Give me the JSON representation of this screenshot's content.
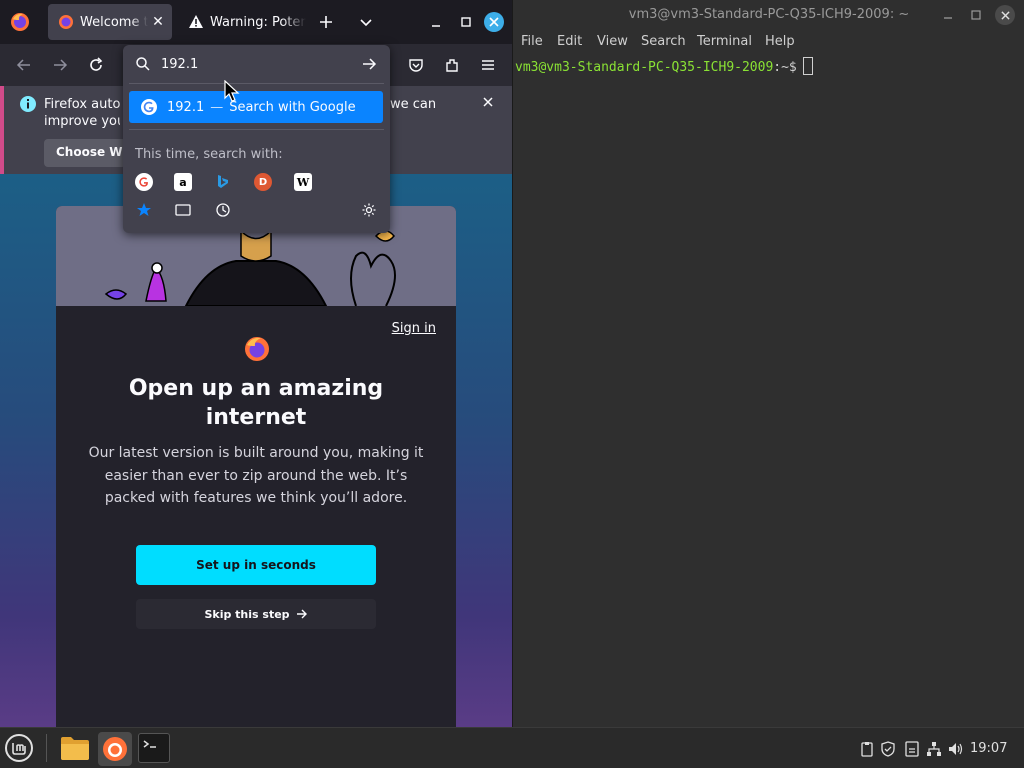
{
  "firefox": {
    "tabs": [
      {
        "title": "Welcome to Firefox",
        "active": true
      },
      {
        "title": "Warning: Potential Security Risk Ahead",
        "active": false
      }
    ],
    "infobar": {
      "text_line1": "Firefox autor",
      "text_line2": "improve your",
      "text_right": "we can",
      "choose_label": "Choose What"
    },
    "card": {
      "sign_in": "Sign in",
      "title": "Open up an amazing internet",
      "body": "Our latest version is built around you, making it easier than ever to zip around the web. It’s packed with features we think you’ll adore.",
      "setup_label": "Set up in seconds",
      "skip_label": "Skip this step"
    },
    "urlbar": {
      "value": "192.1",
      "suggestion_text": "192.1",
      "suggestion_dash": "—",
      "suggestion_action": "Search with Google",
      "search_with_label": "This time, search with:",
      "engines": [
        "google-icon",
        "amazon-icon",
        "bing-icon",
        "duckduckgo-icon",
        "wikipedia-icon"
      ]
    }
  },
  "terminal": {
    "title": "vm3@vm3-Standard-PC-Q35-ICH9-2009: ~",
    "menu": [
      "File",
      "Edit",
      "View",
      "Search",
      "Terminal",
      "Help"
    ],
    "prompt_user": "vm3@vm3-Standard-PC-Q35-ICH9-2009",
    "prompt_tail": ":~$"
  },
  "taskbar": {
    "clock": "19:07"
  },
  "colors": {
    "accent_blue": "#0a84ff",
    "cta_cyan": "#00ddff",
    "prompt_green": "#8ae234",
    "infobar_stripe": "#d14b8a"
  }
}
